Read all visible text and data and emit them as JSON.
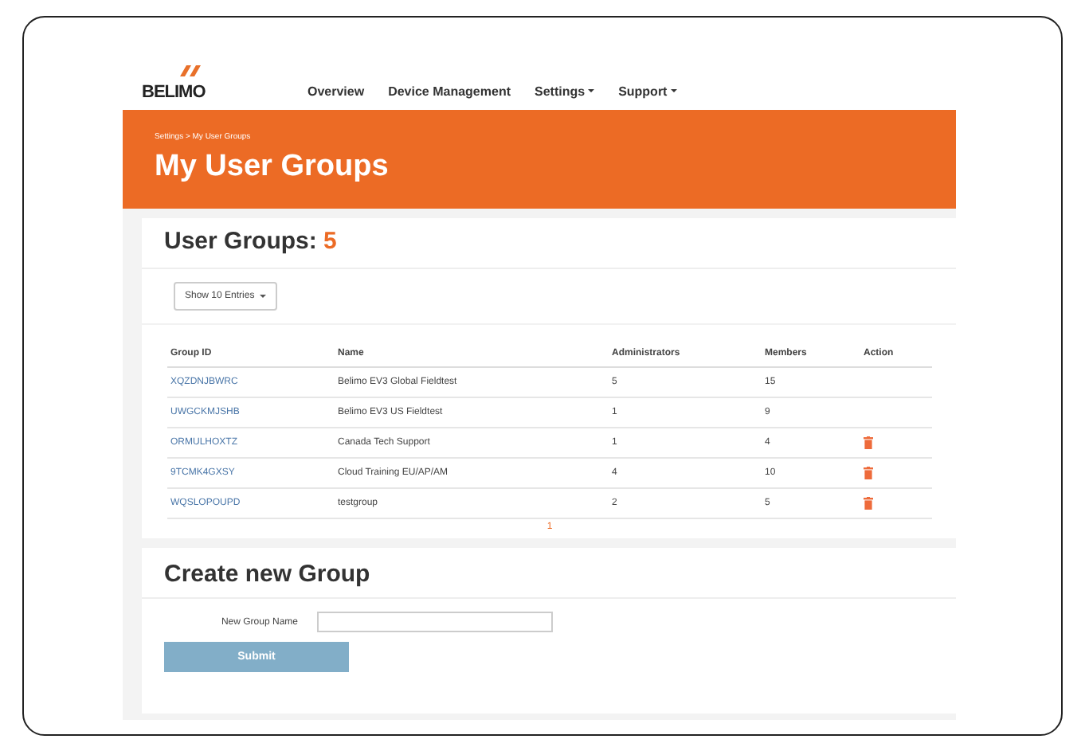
{
  "logo": {
    "text": "BELIMO"
  },
  "nav": [
    {
      "label": "Overview",
      "dropdown": false
    },
    {
      "label": "Device Management",
      "dropdown": false
    },
    {
      "label": "Settings",
      "dropdown": true
    },
    {
      "label": "Support",
      "dropdown": true
    }
  ],
  "banner": {
    "breadcrumb": "Settings > My User Groups",
    "title": "My User Groups"
  },
  "groups_card": {
    "title": "User Groups:",
    "count": "5",
    "entries_button": "Show 10 Entries",
    "table": {
      "columns": [
        "Group ID",
        "Name",
        "Administrators",
        "Members",
        "Action"
      ],
      "rows": [
        {
          "group_id": "XQZDNJBWRC",
          "name": "Belimo EV3 Global Fieldtest",
          "administrators": "5",
          "members": "15",
          "deletable": false
        },
        {
          "group_id": "UWGCKMJSHB",
          "name": "Belimo EV3 US Fieldtest",
          "administrators": "1",
          "members": "9",
          "deletable": false
        },
        {
          "group_id": "ORMULHOXTZ",
          "name": "Canada Tech Support",
          "administrators": "1",
          "members": "4",
          "deletable": true
        },
        {
          "group_id": "9TCMK4GXSY",
          "name": "Cloud Training EU/AP/AM",
          "administrators": "4",
          "members": "10",
          "deletable": true
        },
        {
          "group_id": "WQSLOPOUPD",
          "name": "testgroup",
          "administrators": "2",
          "members": "5",
          "deletable": true
        }
      ]
    },
    "pagination": [
      "1"
    ]
  },
  "create_card": {
    "title": "Create new Group",
    "field_label": "New Group Name",
    "submit": "Submit"
  }
}
